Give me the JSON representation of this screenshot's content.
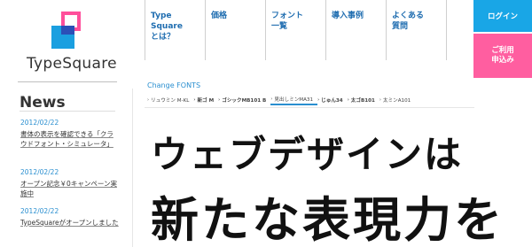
{
  "brand": {
    "name": "TypeSquare"
  },
  "nav": {
    "items": [
      {
        "label": "Type\nSquare\nとは？"
      },
      {
        "label": "価格"
      },
      {
        "label": "フォント\n一覧"
      },
      {
        "label": "導入事例"
      },
      {
        "label": "よくある\n質問"
      }
    ],
    "login_label": "ログイン",
    "apply_label": "ご利用\n申込み"
  },
  "news": {
    "title": "News",
    "items": [
      {
        "date": "2012/02/22",
        "text": "書体の表示を確認できる「クラウドフォント・シミュレータ」"
      },
      {
        "date": "2012/02/22",
        "text": "オープン記念￥0キャンペーン実施中"
      },
      {
        "date": "2012/02/22",
        "text": "TypeSquareがオープンしました"
      }
    ]
  },
  "main": {
    "change_fonts_label": "Change FONTS",
    "font_tabs": [
      {
        "label": "リュウミン M-KL"
      },
      {
        "label": "新ゴ M"
      },
      {
        "label": "ゴシックMB101 B"
      },
      {
        "label": "見出しミンMA31"
      },
      {
        "label": "じゅん34"
      },
      {
        "label": "太ゴB101"
      },
      {
        "label": "太ミンA101"
      }
    ],
    "headline_line1": "ウェブデザインは",
    "headline_line2": "新たな表現力を"
  },
  "colors": {
    "accent_blue": "#19a6e6",
    "accent_pink": "#ff5ea0",
    "link_blue": "#2a8fd0"
  }
}
